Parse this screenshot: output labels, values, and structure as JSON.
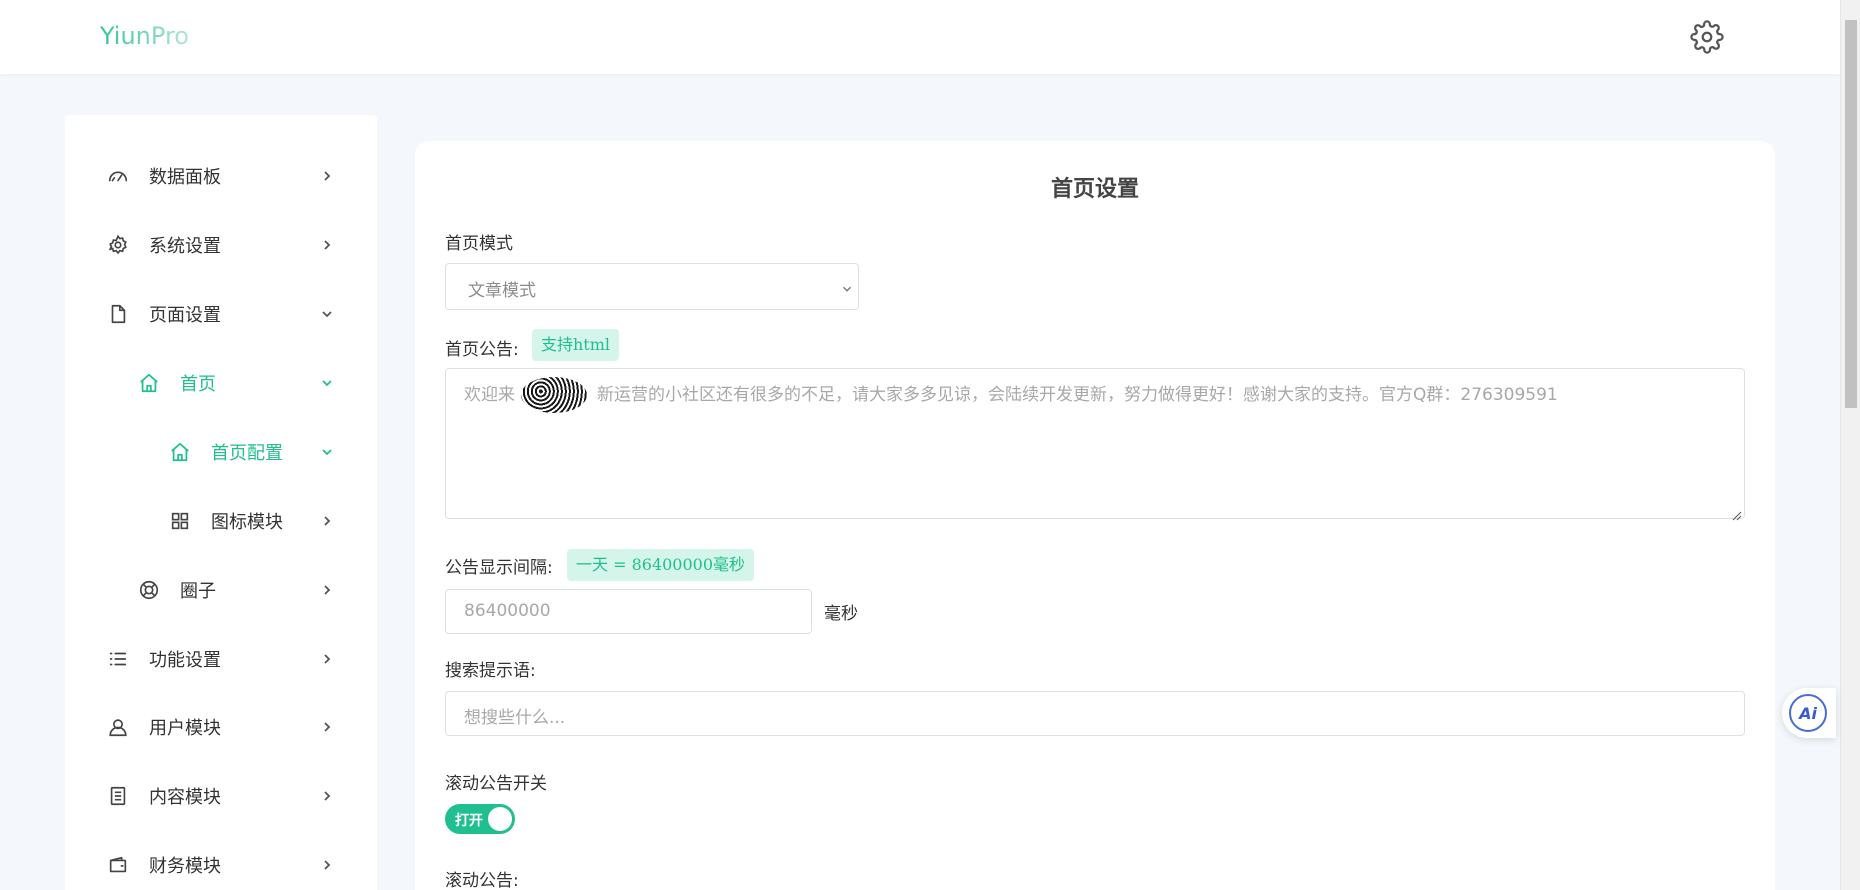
{
  "header": {
    "logo": "YiunPro",
    "settings_icon": "gear-icon"
  },
  "sidebar": {
    "items": [
      {
        "label": "数据面板",
        "icon": "dashboard-gauge-icon",
        "arrow": "chevron-right-icon"
      },
      {
        "label": "系统设置",
        "icon": "gear-icon",
        "arrow": "chevron-right-icon"
      },
      {
        "label": "页面设置",
        "icon": "document-icon",
        "arrow": "chevron-down-icon"
      },
      {
        "label": "首页",
        "icon": "home-icon",
        "arrow": "chevron-down-icon",
        "active": true
      },
      {
        "label": "首页配置",
        "icon": "home-icon",
        "arrow": "chevron-down-icon",
        "active": true
      },
      {
        "label": "图标模块",
        "icon": "grid-icon",
        "arrow": "chevron-right-icon"
      },
      {
        "label": "圈子",
        "icon": "lifebuoy-icon",
        "arrow": "chevron-right-icon"
      },
      {
        "label": "功能设置",
        "icon": "list-icon",
        "arrow": "chevron-right-icon"
      },
      {
        "label": "用户模块",
        "icon": "user-icon",
        "arrow": "chevron-right-icon"
      },
      {
        "label": "内容模块",
        "icon": "notes-icon",
        "arrow": "chevron-right-icon"
      },
      {
        "label": "财务模块",
        "icon": "wallet-icon",
        "arrow": "chevron-right-icon"
      }
    ]
  },
  "form": {
    "title": "首页设置",
    "mode": {
      "label": "首页模式",
      "value": "文章模式"
    },
    "notice": {
      "label": "首页公告:",
      "tag": "支持html",
      "placeholder_before": "欢迎来",
      "placeholder_after": "新运营的小社区还有很多的不足，请大家多多见谅，会陆续开发更新，努力做得更好！感谢大家的支持。官方Q群：276309591"
    },
    "interval": {
      "label": "公告显示间隔:",
      "tag": "一天 = 86400000毫秒",
      "placeholder": "86400000",
      "unit": "毫秒"
    },
    "search_hint": {
      "label": "搜索提示语:",
      "placeholder": "想搜些什么..."
    },
    "scroll_switch": {
      "label": "滚动公告开关",
      "state_text": "打开",
      "on": true
    },
    "scroll_notice": {
      "label": "滚动公告:"
    }
  },
  "floating": {
    "ai_label": "Ai"
  },
  "colors": {
    "accent": "#1fbf8f",
    "tag_bg": "#d6f5ea",
    "ai_blue": "#3a5bd0"
  }
}
